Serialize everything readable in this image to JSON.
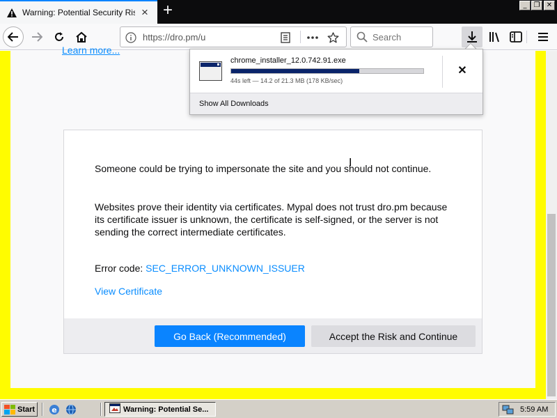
{
  "tab": {
    "title": "Warning: Potential Security Risk A"
  },
  "window_controls": {
    "minimize": "_",
    "restore": "❐",
    "close": "✕"
  },
  "nav": {
    "url": "https://dro.pm/u",
    "search_placeholder": "Search"
  },
  "page": {
    "learn_more": "Learn more...",
    "para1": "Someone could be trying to impersonate the site and you should not continue.",
    "para2": "Websites prove their identity via certificates. Mypal does not trust dro.pm because its certificate issuer is unknown, the certificate is self-signed, or the server is not sending the correct intermediate certificates.",
    "error_label": "Error code: ",
    "error_code": "SEC_ERROR_UNKNOWN_ISSUER",
    "view_certificate": "View Certificate",
    "go_back": "Go Back (Recommended)",
    "accept": "Accept the Risk and Continue"
  },
  "downloads": {
    "filename": "chrome_installer_12.0.742.91.exe",
    "progress_fraction": 0.667,
    "status": "44s left — 14.2 of 21.3 MB (178 KB/sec)",
    "cancel": "✕",
    "show_all": "Show All Downloads"
  },
  "taskbar": {
    "start": "Start",
    "task": "Warning: Potential Se...",
    "clock": "5:59 AM"
  },
  "colors": {
    "accent": "#0a84ff",
    "link": "#0a8dff",
    "highlight_border": "#fffc00",
    "progress": "#0a246a"
  }
}
